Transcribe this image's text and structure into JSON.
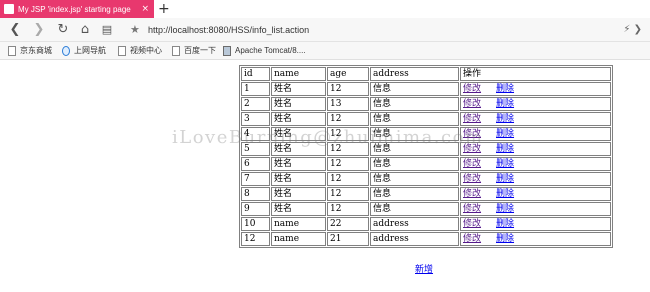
{
  "browser": {
    "tab_title": "My JSP 'index.jsp' starting page",
    "tab_close": "×",
    "new_tab": "+",
    "url": "http://localhost:8080/HSS/info_list.action",
    "bookmarks": [
      "京东商城",
      "上网导航",
      "视频中心",
      "百度一下",
      "Apache Tomcat/8...."
    ]
  },
  "table": {
    "headers": {
      "id": "id",
      "name": "name",
      "age": "age",
      "address": "address",
      "action": "操作"
    },
    "edit_label": "修改",
    "delete_label": "删除",
    "rows": [
      {
        "id": "1",
        "name": "姓名",
        "age": "12",
        "address": "信息"
      },
      {
        "id": "2",
        "name": "姓名",
        "age": "13",
        "address": "信息"
      },
      {
        "id": "3",
        "name": "姓名",
        "age": "12",
        "address": "信息"
      },
      {
        "id": "4",
        "name": "姓名",
        "age": "12",
        "address": "信息"
      },
      {
        "id": "5",
        "name": "姓名",
        "age": "12",
        "address": "信息"
      },
      {
        "id": "6",
        "name": "姓名",
        "age": "12",
        "address": "信息"
      },
      {
        "id": "7",
        "name": "姓名",
        "age": "12",
        "address": "信息"
      },
      {
        "id": "8",
        "name": "姓名",
        "age": "12",
        "address": "信息"
      },
      {
        "id": "9",
        "name": "姓名",
        "age": "12",
        "address": "信息"
      },
      {
        "id": "10",
        "name": "name",
        "age": "22",
        "address": "address"
      },
      {
        "id": "12",
        "name": "name",
        "age": "21",
        "address": "address"
      }
    ]
  },
  "add_link": "新增",
  "watermark": "iLoveBurning@zhuimima.com",
  "colors": {
    "tab_accent": "#e8386e",
    "link": "#0000ee",
    "visited_link": "#551a8b"
  }
}
